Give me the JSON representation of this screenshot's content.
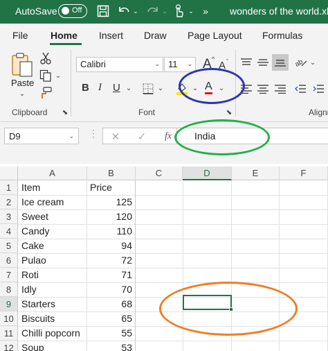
{
  "titlebar": {
    "autosave_label": "AutoSave",
    "autosave_state": "Off",
    "document_title": "wonders of the world.xls"
  },
  "menu": {
    "tabs": [
      {
        "label": "File"
      },
      {
        "label": "Home"
      },
      {
        "label": "Insert"
      },
      {
        "label": "Draw"
      },
      {
        "label": "Page Layout"
      },
      {
        "label": "Formulas"
      }
    ],
    "active": "Home"
  },
  "ribbon": {
    "clipboard": {
      "label": "Clipboard",
      "paste_label": "Paste"
    },
    "font": {
      "label": "Font",
      "font_name": "Calibri",
      "font_size": "11",
      "bold": "B",
      "italic": "I",
      "underline": "U",
      "font_color_glyph": "A",
      "grow_glyph": "A",
      "shrink_glyph": "A"
    },
    "alignment": {
      "label": "Alignm"
    }
  },
  "formula_bar": {
    "name_box": "D9",
    "fx_label": "fx",
    "content": "India"
  },
  "sheet": {
    "columns": [
      "A",
      "B",
      "C",
      "D",
      "E",
      "F"
    ],
    "selected_column": "D",
    "rows": [
      {
        "n": "1",
        "a": "Item",
        "b": "Price"
      },
      {
        "n": "2",
        "a": "Ice cream",
        "b": "125"
      },
      {
        "n": "3",
        "a": "Sweet",
        "b": "120"
      },
      {
        "n": "4",
        "a": "Candy",
        "b": "110"
      },
      {
        "n": "5",
        "a": "Cake",
        "b": "94"
      },
      {
        "n": "6",
        "a": "Pulao",
        "b": "72"
      },
      {
        "n": "7",
        "a": "Roti",
        "b": "71"
      },
      {
        "n": "8",
        "a": "Idly",
        "b": "70"
      },
      {
        "n": "9",
        "a": "Starters",
        "b": "68"
      },
      {
        "n": "10",
        "a": "Biscuits",
        "b": "65"
      },
      {
        "n": "11",
        "a": "Chilli popcorn",
        "b": "55"
      },
      {
        "n": "12",
        "a": "Soup",
        "b": "53"
      }
    ],
    "selected_row": "9"
  },
  "annotations": {
    "blue": "#2b35b8",
    "green": "#22b14c",
    "orange": "#f07d26"
  },
  "colors": {
    "excel_green": "#217346",
    "highlight_yellow": "#ffe600",
    "font_red": "#e21b1b"
  }
}
